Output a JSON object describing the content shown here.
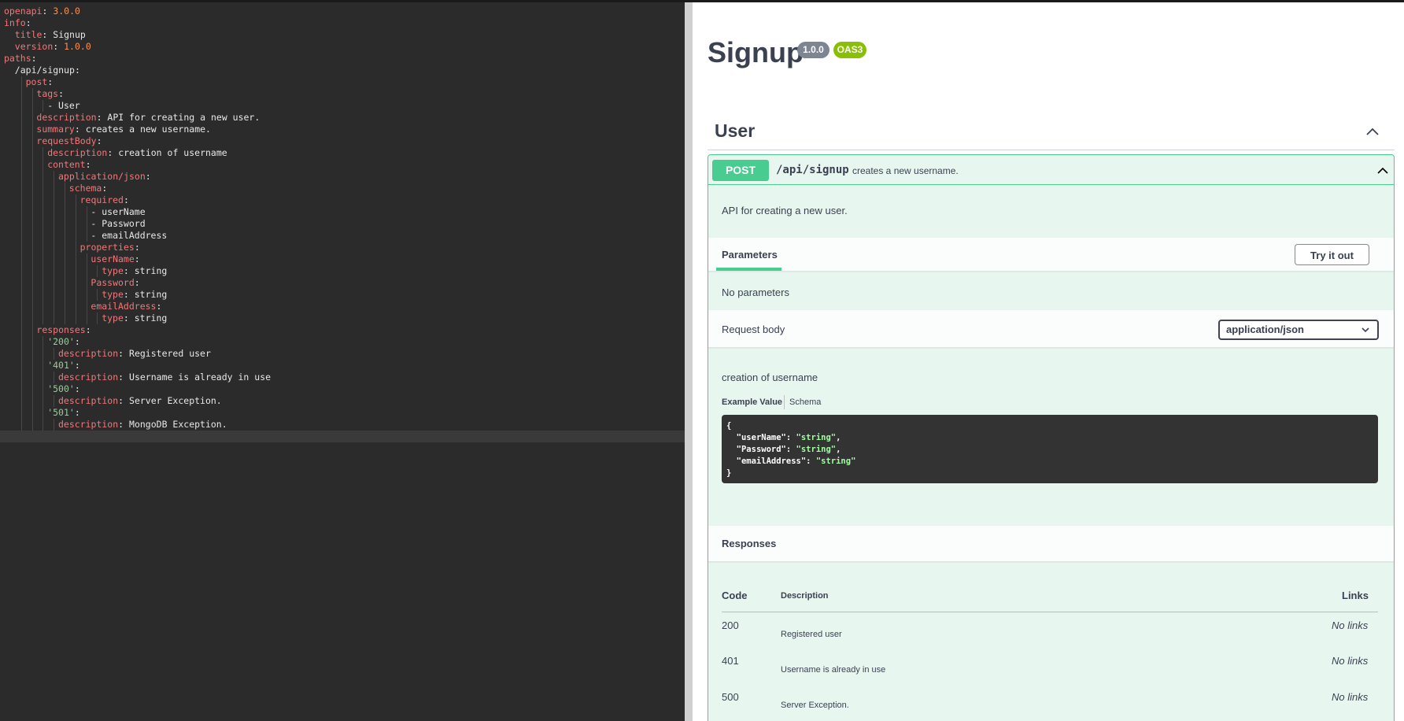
{
  "editor": {
    "lines": [
      {
        "indent": 0,
        "tokens": [
          {
            "t": "openapi",
            "c": "k"
          },
          {
            "t": ": ",
            "c": "p"
          },
          {
            "t": "3.0.0",
            "c": "n"
          }
        ]
      },
      {
        "indent": 0,
        "tokens": [
          {
            "t": "info",
            "c": "k"
          },
          {
            "t": ":",
            "c": "p"
          }
        ]
      },
      {
        "indent": 1,
        "tokens": [
          {
            "t": "title",
            "c": "k"
          },
          {
            "t": ": ",
            "c": "p"
          },
          {
            "t": "Signup",
            "c": "v"
          }
        ]
      },
      {
        "indent": 1,
        "tokens": [
          {
            "t": "version",
            "c": "k"
          },
          {
            "t": ": ",
            "c": "p"
          },
          {
            "t": "1.0.0",
            "c": "n"
          }
        ]
      },
      {
        "indent": 0,
        "tokens": [
          {
            "t": "paths",
            "c": "k"
          },
          {
            "t": ":",
            "c": "p"
          }
        ]
      },
      {
        "indent": 1,
        "tokens": [
          {
            "t": "/api/signup:",
            "c": "v"
          }
        ]
      },
      {
        "indent": 2,
        "tokens": [
          {
            "t": "post",
            "c": "k"
          },
          {
            "t": ":",
            "c": "p"
          }
        ]
      },
      {
        "indent": 3,
        "tokens": [
          {
            "t": "tags",
            "c": "k"
          },
          {
            "t": ":",
            "c": "p"
          }
        ]
      },
      {
        "indent": 4,
        "tokens": [
          {
            "t": "- User",
            "c": "v"
          }
        ]
      },
      {
        "indent": 3,
        "tokens": [
          {
            "t": "description",
            "c": "k"
          },
          {
            "t": ": ",
            "c": "p"
          },
          {
            "t": "API for creating a new user.",
            "c": "v"
          }
        ]
      },
      {
        "indent": 3,
        "tokens": [
          {
            "t": "summary",
            "c": "k"
          },
          {
            "t": ": ",
            "c": "p"
          },
          {
            "t": "creates a new username.",
            "c": "v"
          }
        ]
      },
      {
        "indent": 3,
        "tokens": [
          {
            "t": "requestBody",
            "c": "k"
          },
          {
            "t": ":",
            "c": "p"
          }
        ]
      },
      {
        "indent": 4,
        "tokens": [
          {
            "t": "description",
            "c": "k"
          },
          {
            "t": ": ",
            "c": "p"
          },
          {
            "t": "creation of username",
            "c": "v"
          }
        ]
      },
      {
        "indent": 4,
        "tokens": [
          {
            "t": "content",
            "c": "k"
          },
          {
            "t": ":",
            "c": "p"
          }
        ]
      },
      {
        "indent": 5,
        "tokens": [
          {
            "t": "application/json",
            "c": "k"
          },
          {
            "t": ":",
            "c": "p"
          }
        ]
      },
      {
        "indent": 6,
        "tokens": [
          {
            "t": "schema",
            "c": "k"
          },
          {
            "t": ":",
            "c": "p"
          }
        ]
      },
      {
        "indent": 7,
        "tokens": [
          {
            "t": "required",
            "c": "k"
          },
          {
            "t": ":",
            "c": "p"
          }
        ]
      },
      {
        "indent": 8,
        "tokens": [
          {
            "t": "- userName",
            "c": "v"
          }
        ]
      },
      {
        "indent": 8,
        "tokens": [
          {
            "t": "- Password",
            "c": "v"
          }
        ]
      },
      {
        "indent": 8,
        "tokens": [
          {
            "t": "- emailAddress",
            "c": "v"
          }
        ]
      },
      {
        "indent": 7,
        "tokens": [
          {
            "t": "properties",
            "c": "k"
          },
          {
            "t": ":",
            "c": "p"
          }
        ]
      },
      {
        "indent": 8,
        "tokens": [
          {
            "t": "userName",
            "c": "k"
          },
          {
            "t": ":",
            "c": "p"
          }
        ]
      },
      {
        "indent": 9,
        "tokens": [
          {
            "t": "type",
            "c": "k"
          },
          {
            "t": ": ",
            "c": "p"
          },
          {
            "t": "string",
            "c": "v"
          }
        ]
      },
      {
        "indent": 8,
        "tokens": [
          {
            "t": "Password",
            "c": "k"
          },
          {
            "t": ":",
            "c": "p"
          }
        ]
      },
      {
        "indent": 9,
        "tokens": [
          {
            "t": "type",
            "c": "k"
          },
          {
            "t": ": ",
            "c": "p"
          },
          {
            "t": "string",
            "c": "v"
          }
        ]
      },
      {
        "indent": 8,
        "tokens": [
          {
            "t": "emailAddress",
            "c": "k"
          },
          {
            "t": ":",
            "c": "p"
          }
        ]
      },
      {
        "indent": 9,
        "tokens": [
          {
            "t": "type",
            "c": "k"
          },
          {
            "t": ": ",
            "c": "p"
          },
          {
            "t": "string",
            "c": "v"
          }
        ]
      },
      {
        "indent": 3,
        "tokens": [
          {
            "t": "responses",
            "c": "k"
          },
          {
            "t": ":",
            "c": "p"
          }
        ]
      },
      {
        "indent": 4,
        "tokens": [
          {
            "t": "'200'",
            "c": "s"
          },
          {
            "t": ":",
            "c": "p"
          }
        ]
      },
      {
        "indent": 5,
        "tokens": [
          {
            "t": "description",
            "c": "k"
          },
          {
            "t": ": ",
            "c": "p"
          },
          {
            "t": "Registered user",
            "c": "v"
          }
        ]
      },
      {
        "indent": 4,
        "tokens": [
          {
            "t": "'401'",
            "c": "s"
          },
          {
            "t": ":",
            "c": "p"
          }
        ]
      },
      {
        "indent": 5,
        "tokens": [
          {
            "t": "description",
            "c": "k"
          },
          {
            "t": ": ",
            "c": "p"
          },
          {
            "t": "Username is already in use",
            "c": "v"
          }
        ]
      },
      {
        "indent": 4,
        "tokens": [
          {
            "t": "'500'",
            "c": "s"
          },
          {
            "t": ":",
            "c": "p"
          }
        ]
      },
      {
        "indent": 5,
        "tokens": [
          {
            "t": "description",
            "c": "k"
          },
          {
            "t": ": ",
            "c": "p"
          },
          {
            "t": "Server Exception.",
            "c": "v"
          }
        ]
      },
      {
        "indent": 4,
        "tokens": [
          {
            "t": "'501'",
            "c": "s"
          },
          {
            "t": ":",
            "c": "p"
          }
        ]
      },
      {
        "indent": 5,
        "tokens": [
          {
            "t": "description",
            "c": "k"
          },
          {
            "t": ": ",
            "c": "p"
          },
          {
            "t": "MongoDB Exception.",
            "c": "v"
          }
        ]
      },
      {
        "indent": 0,
        "tokens": [],
        "active": true
      }
    ]
  },
  "swagger": {
    "title": "Signup",
    "version_badge": "1.0.0",
    "oas_badge": "OAS3",
    "tag": "User",
    "operation": {
      "method": "POST",
      "path": "/api/signup",
      "summary": "creates a new username.",
      "description": "API for creating a new user.",
      "parameters_tab": "Parameters",
      "try_button": "Try it out",
      "no_parameters": "No parameters",
      "request_body_label": "Request body",
      "content_type": "application/json",
      "request_body_description": "creation of username",
      "example_value_tab": "Example Value",
      "schema_tab": "Schema",
      "example": {
        "open": "{",
        "close": "}",
        "fields": [
          {
            "key": "\"userName\"",
            "value": "\"string\"",
            "trail": ","
          },
          {
            "key": "\"Password\"",
            "value": "\"string\"",
            "trail": ","
          },
          {
            "key": "\"emailAddress\"",
            "value": "\"string\"",
            "trail": ""
          }
        ]
      },
      "responses_label": "Responses",
      "responses_table": {
        "headers": {
          "code": "Code",
          "description": "Description",
          "links": "Links"
        },
        "rows": [
          {
            "code": "200",
            "description": "Registered user",
            "links": "No links"
          },
          {
            "code": "401",
            "description": "Username is already in use",
            "links": "No links"
          },
          {
            "code": "500",
            "description": "Server Exception.",
            "links": "No links"
          }
        ]
      }
    }
  },
  "colors": {
    "post_green": "#49cc90",
    "op_background": "#e8f6f0",
    "editor_background": "#2b2b2b",
    "yaml_key": "#f2777a",
    "yaml_number": "#f99157",
    "yaml_string": "#99cc99",
    "version_badge": "#7d8492",
    "oas_badge": "#89bf04"
  }
}
